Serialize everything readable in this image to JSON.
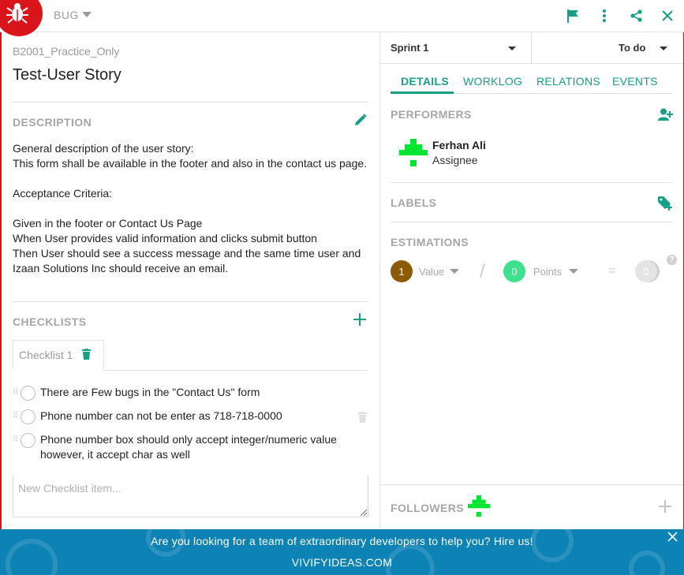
{
  "header": {
    "type_label": "BUG",
    "icons": [
      "bug-logo-icon",
      "flag-icon",
      "more-vertical-icon",
      "share-icon",
      "close-icon"
    ]
  },
  "colors": {
    "brand_red": "#d9151b",
    "accent_teal": "#17a086",
    "value_circle": "#8e5a00",
    "points_circle": "#3de08c",
    "banner_blue": "#0d82b5",
    "identicon_green": "#00e532"
  },
  "story": {
    "project_key": "B2001_Practice_Only",
    "title": "Test-User Story"
  },
  "description": {
    "heading": "DESCRIPTION",
    "text": "General description of the user story:\nThis form shall be available in the footer and also in the contact us page.\n\nAcceptance Criteria:\n\nGiven in the footer or Contact Us Page\nWhen User provides valid information and  clicks submit button\nThen User should see a success message and the same time user and Izaan Solutions Inc should receive an email."
  },
  "checklists": {
    "heading": "CHECKLISTS",
    "tab_label": "Checklist 1",
    "items": [
      {
        "text": "There are Few bugs in the \"Contact Us\" form"
      },
      {
        "text": "Phone number can not be enter as 718-718-0000"
      },
      {
        "text": "Phone number box should only accept integer/numeric value however, it accept char as well"
      }
    ],
    "new_item_placeholder": "New Checklist item..."
  },
  "sidebar": {
    "sprint": "Sprint 1",
    "status": "To do",
    "tabs": [
      "DETAILS",
      "WORKLOG",
      "RELATIONS",
      "EVENTS"
    ],
    "active_tab": "DETAILS",
    "performers": {
      "heading": "PERFORMERS",
      "name": "Ferhan Ali",
      "role": "Assignee"
    },
    "labels": {
      "heading": "LABELS"
    },
    "estimations": {
      "heading": "ESTIMATIONS",
      "value_num": "1",
      "value_label": "Value",
      "points_num": "0",
      "points_label": "Points",
      "equals": "=",
      "result": "0",
      "help": "?",
      "divider": "/"
    },
    "followers": {
      "heading": "FOLLOWERS"
    }
  },
  "banner": {
    "message": "Are you looking for a team of extraordinary developers to help you? Hire us!",
    "link": "VIVIFYIDEAS.COM"
  }
}
